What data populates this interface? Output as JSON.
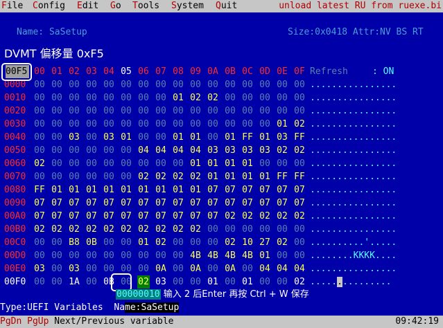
{
  "menu": [
    "File",
    "Config",
    "Edit",
    "Go",
    "Tools",
    "System",
    "Quit"
  ],
  "menu_hotkeys": [
    "F",
    "C",
    "E",
    "G",
    "T",
    "S",
    "Q"
  ],
  "menu_rest": [
    "ile",
    "onfig",
    "dit",
    "o",
    "ools",
    "ystem",
    "uit"
  ],
  "unload_text": "unload latest RU from ruexe.bi",
  "name_label": "Name: SaSetup",
  "size_attr": "Size:0x0418 Attr:NV BS RT",
  "heading": "DVMT 偏移量 0xF5",
  "corner": "00F5",
  "col_headers": [
    "00",
    "01",
    "02",
    "03",
    "04",
    "05",
    "06",
    "07",
    "08",
    "09",
    "0A",
    "0B",
    "0C",
    "0D",
    "0E",
    "0F"
  ],
  "refresh_label": "Refresh",
  "refresh_value": ": ON",
  "rows": [
    {
      "addr": "0000",
      "bytes": [
        "00",
        "00",
        "00",
        "00",
        "00",
        "00",
        "00",
        "00",
        "00",
        "00",
        "00",
        "00",
        "00",
        "00",
        "00",
        "00"
      ],
      "ascii": "................"
    },
    {
      "addr": "0010",
      "bytes": [
        "00",
        "00",
        "00",
        "00",
        "00",
        "00",
        "00",
        "00",
        "01",
        "02",
        "02",
        "00",
        "00",
        "00",
        "00",
        "00"
      ],
      "ascii": "................"
    },
    {
      "addr": "0020",
      "bytes": [
        "00",
        "00",
        "00",
        "00",
        "00",
        "00",
        "00",
        "00",
        "00",
        "00",
        "00",
        "00",
        "00",
        "00",
        "00",
        "00"
      ],
      "ascii": "................"
    },
    {
      "addr": "0030",
      "bytes": [
        "00",
        "00",
        "00",
        "00",
        "00",
        "00",
        "00",
        "00",
        "00",
        "00",
        "00",
        "00",
        "00",
        "00",
        "01",
        "02"
      ],
      "ascii": "................"
    },
    {
      "addr": "0040",
      "bytes": [
        "00",
        "00",
        "03",
        "00",
        "03",
        "01",
        "00",
        "00",
        "01",
        "01",
        "00",
        "01",
        "FF",
        "01",
        "03",
        "FF"
      ],
      "ascii": "................"
    },
    {
      "addr": "0050",
      "bytes": [
        "00",
        "00",
        "00",
        "00",
        "00",
        "00",
        "04",
        "04",
        "04",
        "04",
        "03",
        "03",
        "03",
        "03",
        "02",
        "02"
      ],
      "ascii": "................"
    },
    {
      "addr": "0060",
      "bytes": [
        "02",
        "00",
        "00",
        "00",
        "00",
        "00",
        "00",
        "00",
        "00",
        "01",
        "01",
        "01",
        "01",
        "00",
        "00",
        "00"
      ],
      "ascii": "................"
    },
    {
      "addr": "0070",
      "bytes": [
        "00",
        "00",
        "00",
        "00",
        "00",
        "00",
        "02",
        "02",
        "02",
        "02",
        "01",
        "01",
        "01",
        "01",
        "FF",
        "FF"
      ],
      "ascii": "................"
    },
    {
      "addr": "0080",
      "bytes": [
        "FF",
        "01",
        "01",
        "01",
        "01",
        "01",
        "01",
        "01",
        "01",
        "01",
        "07",
        "07",
        "07",
        "07",
        "07",
        "07"
      ],
      "ascii": "................"
    },
    {
      "addr": "0090",
      "bytes": [
        "07",
        "07",
        "07",
        "07",
        "07",
        "07",
        "07",
        "07",
        "07",
        "07",
        "07",
        "07",
        "07",
        "07",
        "07",
        "07"
      ],
      "ascii": "................"
    },
    {
      "addr": "00A0",
      "bytes": [
        "07",
        "07",
        "07",
        "07",
        "07",
        "07",
        "07",
        "07",
        "07",
        "07",
        "07",
        "02",
        "02",
        "02",
        "02",
        "02"
      ],
      "ascii": "................"
    },
    {
      "addr": "00B0",
      "bytes": [
        "02",
        "02",
        "02",
        "02",
        "02",
        "02",
        "02",
        "02",
        "02",
        "02",
        "00",
        "00",
        "00",
        "00",
        "00",
        "00"
      ],
      "ascii": "................"
    },
    {
      "addr": "00C0",
      "bytes": [
        "00",
        "00",
        "B8",
        "0B",
        "00",
        "00",
        "01",
        "02",
        "00",
        "00",
        "00",
        "02",
        "10",
        "27",
        "02",
        "00"
      ],
      "ascii": "..........'....."
    },
    {
      "addr": "00D0",
      "bytes": [
        "00",
        "00",
        "00",
        "00",
        "00",
        "00",
        "00",
        "00",
        "00",
        "4B",
        "4B",
        "4B",
        "4B",
        "01",
        "00",
        "00"
      ],
      "ascii": "........KKKK...."
    },
    {
      "addr": "00E0",
      "bytes": [
        "03",
        "00",
        "03",
        "00",
        "00",
        "00",
        "00",
        "0A",
        "00",
        "0A",
        "00",
        "0A",
        "00",
        "04",
        "04",
        "04"
      ],
      "ascii": "................"
    },
    {
      "addr": "00F0",
      "bytes": [
        "00",
        "00",
        "1A",
        "00",
        "0B",
        "00",
        "02",
        "03",
        "00",
        "00",
        "01",
        "00",
        "01",
        "00",
        "00",
        "02"
      ],
      "ascii": ".....",
      "ascii_cursor": ".",
      "ascii_after": "........."
    }
  ],
  "tooltip_value": "00000010",
  "tooltip_text": "输入 2 后Enter 再按 Ctrl + W 保存",
  "type_label": "Type:UEFI Variables",
  "type_name_prefix": "Na",
  "type_name_rest": "me:SaSetup",
  "status_keys": "PgDn PgUp",
  "status_text": "Next/Previous variable",
  "clock": "09:42:19",
  "colors": {
    "background": "#0000a8",
    "menubar": "#c6c6c6",
    "hotkey": "#b00000",
    "nonzero": "#ffff55",
    "zero": "#5b7fb0",
    "address": "#ff2a2a",
    "selected": "#008000"
  }
}
